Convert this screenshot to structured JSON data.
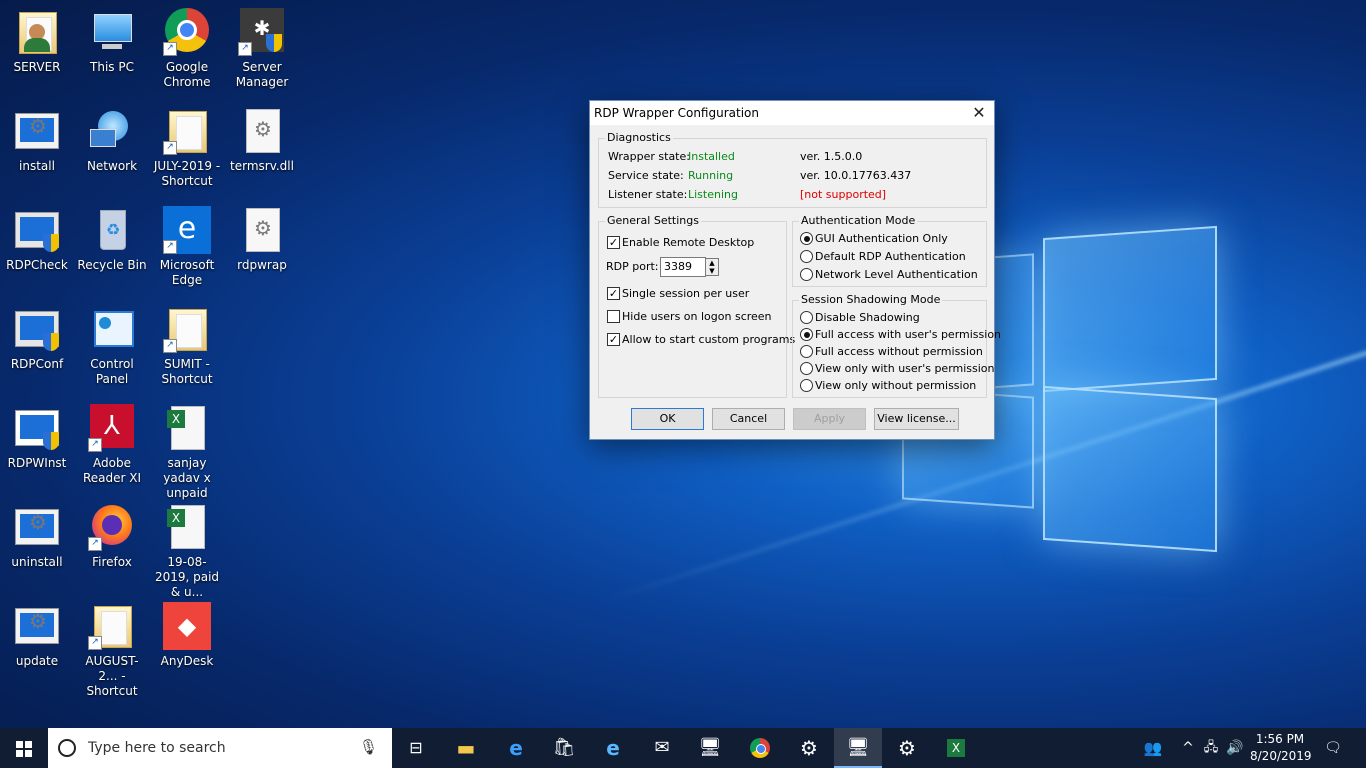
{
  "desktop": {
    "icons": [
      {
        "label": "SERVER",
        "icon": "user-folder-icon"
      },
      {
        "label": "This PC",
        "icon": "computer-icon"
      },
      {
        "label": "Google Chrome",
        "icon": "chrome-icon"
      },
      {
        "label": "Server Manager",
        "icon": "server-manager-icon"
      },
      {
        "label": "install",
        "icon": "batch-gear-icon"
      },
      {
        "label": "Network",
        "icon": "network-icon"
      },
      {
        "label": "JULY-2019 - Shortcut",
        "icon": "folder-icon"
      },
      {
        "label": "termsrv.dll",
        "icon": "dll-gear-icon"
      },
      {
        "label": "RDPCheck",
        "icon": "monitor-shield-icon"
      },
      {
        "label": "Recycle Bin",
        "icon": "recycle-bin-icon"
      },
      {
        "label": "Microsoft Edge",
        "icon": "edge-icon"
      },
      {
        "label": "rdpwrap",
        "icon": "gear-file-icon"
      },
      {
        "label": "RDPConf",
        "icon": "monitor-shield-icon"
      },
      {
        "label": "Control Panel",
        "icon": "control-panel-icon"
      },
      {
        "label": "SUMIT - Shortcut",
        "icon": "folder-icon"
      },
      {
        "label": "RDPWInst",
        "icon": "window-shield-icon"
      },
      {
        "label": "Adobe Reader XI",
        "icon": "acrobat-icon"
      },
      {
        "label": "sanjay yadav x unpaid",
        "icon": "excel-file-icon"
      },
      {
        "label": "uninstall",
        "icon": "batch-gear-icon"
      },
      {
        "label": "Firefox",
        "icon": "firefox-icon"
      },
      {
        "label": "19-08-2019, paid & u...",
        "icon": "excel-file-icon"
      },
      {
        "label": "update",
        "icon": "batch-gear-icon"
      },
      {
        "label": "AUGUST-2... - Shortcut",
        "icon": "folder-icon"
      },
      {
        "label": "AnyDesk",
        "icon": "anydesk-icon"
      }
    ]
  },
  "dialog": {
    "title": "RDP Wrapper Configuration",
    "diagnostics": {
      "title": "Diagnostics",
      "wrapper_label": "Wrapper state:",
      "wrapper_value": "Installed",
      "wrapper_ver": "ver.  1.5.0.0",
      "service_label": "Service state:",
      "service_value": "Running",
      "service_ver": "ver.  10.0.17763.437",
      "listener_label": "Listener state:",
      "listener_value": "Listening",
      "listener_ver": "[not supported]"
    },
    "general": {
      "title": "General Settings",
      "enable_rd": "Enable Remote Desktop",
      "port_label": "RDP port:",
      "port_value": "3389",
      "single_session": "Single session per user",
      "hide_users": "Hide users on logon screen",
      "custom_programs": "Allow to start custom programs"
    },
    "auth": {
      "title": "Authentication Mode",
      "gui": "GUI Authentication Only",
      "default": "Default RDP Authentication",
      "nla": "Network Level Authentication"
    },
    "shadow": {
      "title": "Session Shadowing Mode",
      "disable": "Disable Shadowing",
      "full_perm": "Full access with user's permission",
      "full_noperm": "Full access without permission",
      "view_perm": "View only with user's permission",
      "view_noperm": "View only without permission"
    },
    "buttons": {
      "ok": "OK",
      "cancel": "Cancel",
      "apply": "Apply",
      "license": "View license..."
    }
  },
  "taskbar": {
    "search_placeholder": "Type here to search",
    "time": "1:56 PM",
    "date": "8/20/2019"
  }
}
